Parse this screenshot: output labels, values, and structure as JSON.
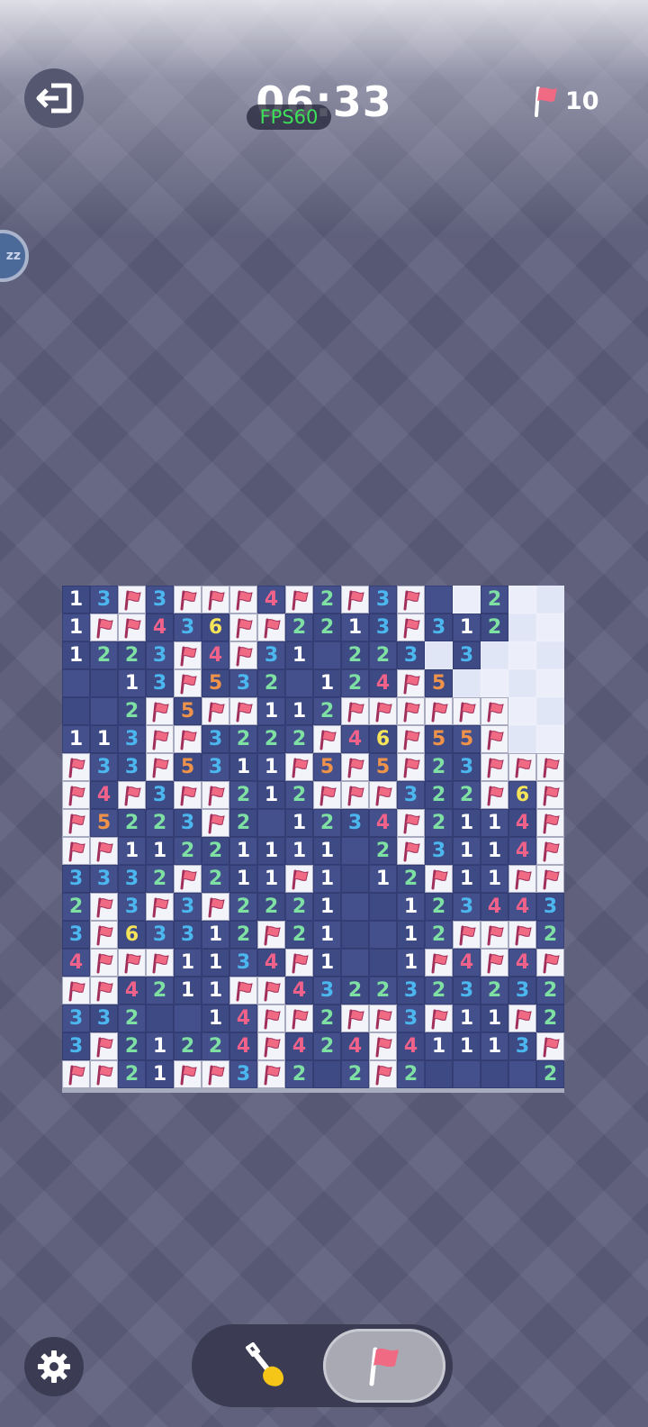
{
  "header": {
    "exit_icon": "exit-icon",
    "timer": "06:33",
    "fps_label": "FPS60",
    "flags_remaining": "10",
    "side_bubble_text": "zz"
  },
  "colors": {
    "1": "#ffffff",
    "2": "#7ee0a3",
    "3": "#4cb6ef",
    "4": "#f0628a",
    "5": "#f0934a",
    "6": "#f5e35a",
    "flag": "#f06a84",
    "open_cell": "#3e4a84",
    "hidden_cell": "#eceff9"
  },
  "legend": "digits = revealed count, F = flagged cell, . = revealed empty, H = unrevealed cell",
  "board": {
    "rows": 18,
    "cols": 18,
    "grid": [
      "13F3FFF4F2F3F.H2HH",
      "1FF436FF2213F312HH",
      "1223F4F31.223H3HHH",
      "..13F532.124F5HHHH",
      "..2F5FF112FFFFFFHH",
      "113FF3222F46F55FHH",
      "F33F5311F5F5F23FFF",
      "F4F3FF212FFF322F6F",
      "F5223F2.1234F2114F",
      "FF11221111.2F3114F",
      "3332F211F1.12F11FF",
      "2F3F3F2221..12344 3",
      "3F633 12F21..12FFF2",
      "4FFF113 4F1..1F4F4F",
      "FF4211FF43223 23232",
      "332..14FF2FF3F11F2",
      "3F2122 4F424F4111 3F",
      "FF21FF3F2.2F2....2F"
    ]
  },
  "controls": {
    "settings_icon": "gear-icon",
    "dig_icon": "shovel-icon",
    "flag_mode_icon": "flag-icon",
    "active_mode": "flag"
  }
}
